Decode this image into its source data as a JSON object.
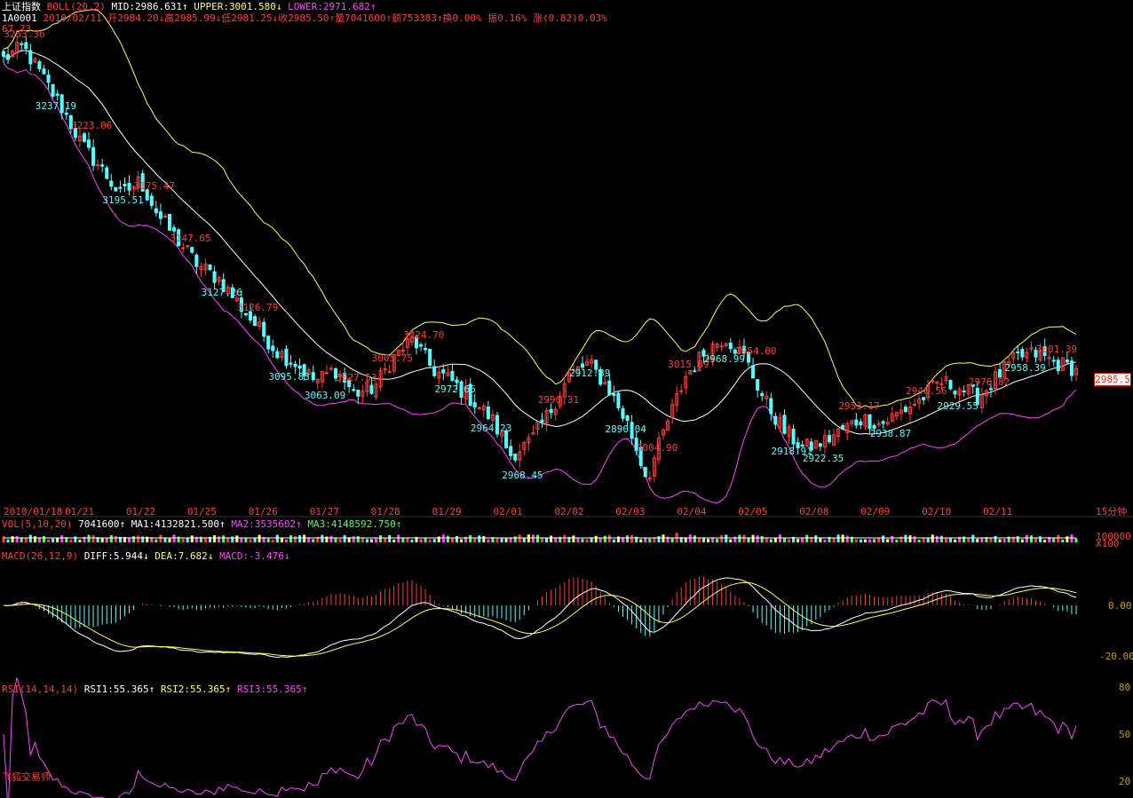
{
  "header": {
    "index_name": "上证指数",
    "boll_label": "BOLL(20,2)",
    "mid": "MID:2986.631↑",
    "upper": "UPPER:3001.580↓",
    "lower": "LOWER:2971.682↑",
    "code": "1A0001",
    "date": "2010/02/11",
    "open": "开2984.20↓",
    "high": "高2985.99↓",
    "low": "低2981.25↓",
    "close": "收2985.50↑",
    "volume": "量7041600↑",
    "amount": "额753383↑",
    "turnover": "换0.00%",
    "amplitude": "振0.16%",
    "change": "涨(0.82)0.03%"
  },
  "price_panel": {
    "top_left_label": "67.73",
    "current_price_tag": "2985.5",
    "annotations": [
      {
        "text": "3253.36",
        "color": "red"
      },
      {
        "text": "3237.19",
        "color": "cyan"
      },
      {
        "text": "3223.06",
        "color": "red"
      },
      {
        "text": "3195.51",
        "color": "cyan"
      },
      {
        "text": "3175.47",
        "color": "red"
      },
      {
        "text": "3147.65",
        "color": "red"
      },
      {
        "text": "3127.26",
        "color": "cyan"
      },
      {
        "text": "3126.79",
        "color": "red"
      },
      {
        "text": "3095.83",
        "color": "cyan"
      },
      {
        "text": "3063.09",
        "color": "cyan"
      },
      {
        "text": "3027.53",
        "color": "red"
      },
      {
        "text": "3005.75",
        "color": "red"
      },
      {
        "text": "3024.70",
        "color": "red"
      },
      {
        "text": "2972.66",
        "color": "cyan"
      },
      {
        "text": "2964.23",
        "color": "cyan"
      },
      {
        "text": "2968.45",
        "color": "cyan"
      },
      {
        "text": "2990.31",
        "color": "red"
      },
      {
        "text": "2912.89",
        "color": "cyan"
      },
      {
        "text": "2890.04",
        "color": "cyan"
      },
      {
        "text": "3004.90",
        "color": "red"
      },
      {
        "text": "3015.09",
        "color": "red"
      },
      {
        "text": "2968.99",
        "color": "cyan"
      },
      {
        "text": "2954.00",
        "color": "red"
      },
      {
        "text": "2918.91",
        "color": "cyan"
      },
      {
        "text": "2922.35",
        "color": "cyan"
      },
      {
        "text": "2953.17",
        "color": "red"
      },
      {
        "text": "2938.87",
        "color": "cyan"
      },
      {
        "text": "2946.56",
        "color": "red"
      },
      {
        "text": "2929.55",
        "color": "cyan"
      },
      {
        "text": "2976.82",
        "color": "red"
      },
      {
        "text": "2958.39",
        "color": "cyan"
      },
      {
        "text": "3001.39",
        "color": "red"
      }
    ]
  },
  "time_axis": {
    "labels": [
      "2010/01/18",
      "01/21",
      "01/22",
      "01/25",
      "01/26",
      "01/27",
      "01/28",
      "01/29",
      "02/01",
      "02/02",
      "02/03",
      "02/04",
      "02/05",
      "02/08",
      "02/09",
      "02/10",
      "02/11"
    ],
    "period": "15分钟"
  },
  "vol_panel": {
    "label": "VOL(5,10,20)",
    "value": "7041600↑",
    "ma1": "MA1:4132821.500↑",
    "ma2": "MA2:3535602↑",
    "ma3": "MA3:4148592.750↑",
    "axis_top": "100000",
    "axis_unit": "X100"
  },
  "macd_panel": {
    "label": "MACD(26,12,9)",
    "diff": "DIFF:5.944↓",
    "dea": "DEA:7.682↓",
    "macd": "MACD:-3.476↓",
    "axis": [
      "0.00",
      "-20.00"
    ]
  },
  "rsi_panel": {
    "label": "RSI(14,14,14)",
    "rsi1": "RSI1:55.365↑",
    "rsi2": "RSI2:55.365↑",
    "rsi3": "RSI3:55.365↑",
    "axis": [
      "80",
      "50",
      "20"
    ]
  },
  "watermark": "飞狐交易师",
  "colors": {
    "background": "#000000",
    "up": "#ff3b3b",
    "down": "#55ffff",
    "mid": "#ffffff",
    "upper": "#ffff55",
    "lower": "#ff44ff",
    "rsi": "#ff44ff"
  },
  "chart_data": {
    "type": "candlestick",
    "title": "上证指数",
    "period": "15分钟",
    "x_date_labels": [
      "2010/01/18",
      "01/21",
      "01/22",
      "01/25",
      "01/26",
      "01/27",
      "01/28",
      "01/29",
      "02/01",
      "02/02",
      "02/03",
      "02/04",
      "02/05",
      "02/08",
      "02/09",
      "02/10",
      "02/11"
    ],
    "price_range": [
      2880,
      3268
    ],
    "anchor_prices": [
      3240,
      3250,
      3225,
      3200,
      3170,
      3150,
      3128,
      3140,
      3110,
      3090,
      3070,
      3060,
      3040,
      3020,
      3000,
      2990,
      2975,
      2985,
      2965,
      2970,
      2995,
      3010,
      2985,
      2975,
      2960,
      2945,
      2915,
      2925,
      2950,
      2980,
      2990,
      2970,
      2940,
      2895,
      2940,
      2980,
      3000,
      3012,
      2995,
      2960,
      2935,
      2920,
      2925,
      2935,
      2945,
      2940,
      2950,
      2960,
      2975,
      2970,
      2962,
      2980,
      2995,
      2998,
      2990,
      2985.5
    ],
    "last_bar": {
      "date": "2010/02/11",
      "open": 2984.2,
      "high": 2985.99,
      "low": 2981.25,
      "close": 2985.5,
      "volume": 7041600
    },
    "bollinger": {
      "period": 20,
      "k": 2,
      "mid": 2986.631,
      "upper": 3001.58,
      "lower": 2971.682
    },
    "macd": {
      "diff": 5.944,
      "dea": 7.682,
      "macd": -3.476,
      "axis_range": [
        -25,
        12
      ]
    },
    "rsi": {
      "rsi1": 55.365,
      "rsi2": 55.365,
      "rsi3": 55.365,
      "axis_range": [
        20,
        80
      ]
    }
  }
}
